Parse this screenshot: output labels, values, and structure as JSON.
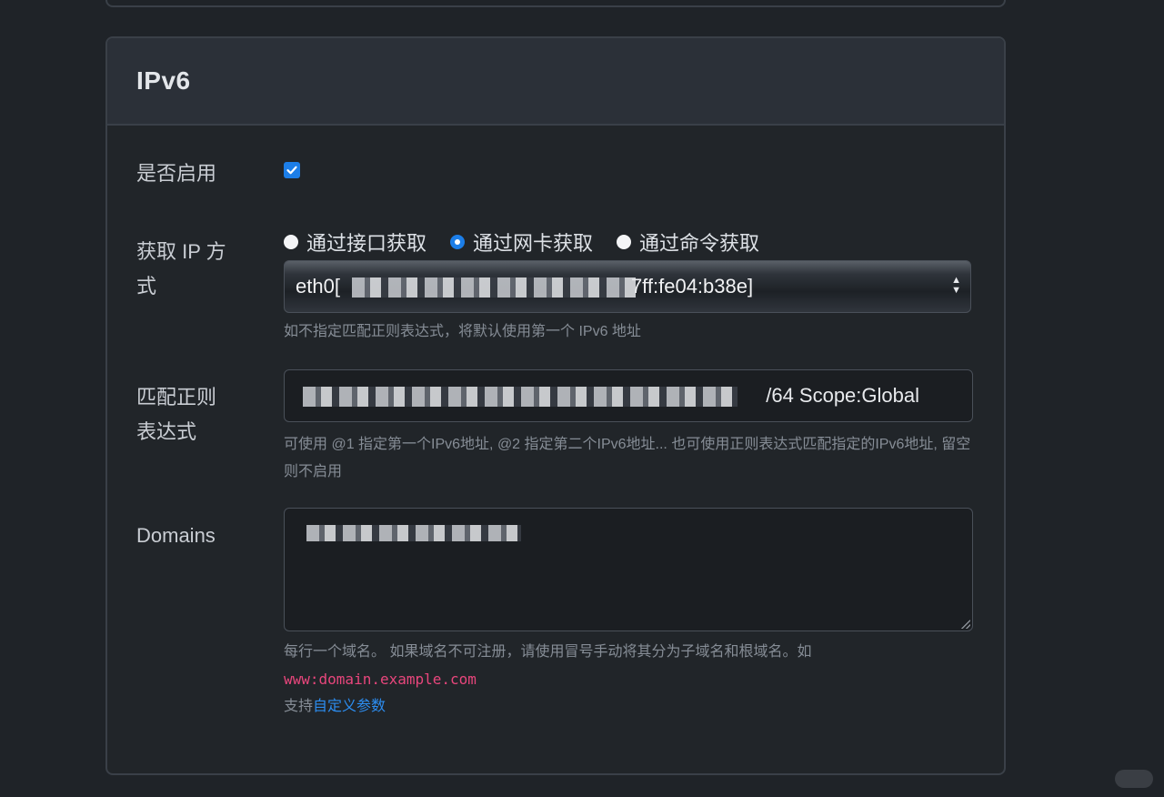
{
  "card": {
    "title": "IPv6"
  },
  "enable": {
    "label": "是否启用",
    "checked": true
  },
  "ip_method": {
    "label": "获取 IP 方式",
    "options": [
      "通过接口获取",
      "通过网卡获取",
      "通过命令获取"
    ],
    "selected_index": 1,
    "select_value_start": "eth0[",
    "select_value_end": "7ff:fe04:b38e]",
    "help": "如不指定匹配正则表达式，将默认使用第一个 IPv6 地址"
  },
  "regex": {
    "label_line1": "匹配正则",
    "label_line2": "表达式",
    "value_end": "/64 Scope:Global",
    "help": "可使用 @1 指定第一个IPv6地址, @2 指定第二个IPv6地址... 也可使用正则表达式匹配指定的IPv6地址, 留空则不启用"
  },
  "domains": {
    "label": "Domains",
    "help_line1": "每行一个域名。 如果域名不可注册，请使用冒号手动将其分为子域名和根域名。如",
    "help_example": "www:domain.example.com",
    "help_support_prefix": "支持",
    "help_support_link": "自定义参数"
  },
  "colors": {
    "accent": "#1c7ee8",
    "link": "#2c8df0",
    "code": "#e8467c"
  }
}
